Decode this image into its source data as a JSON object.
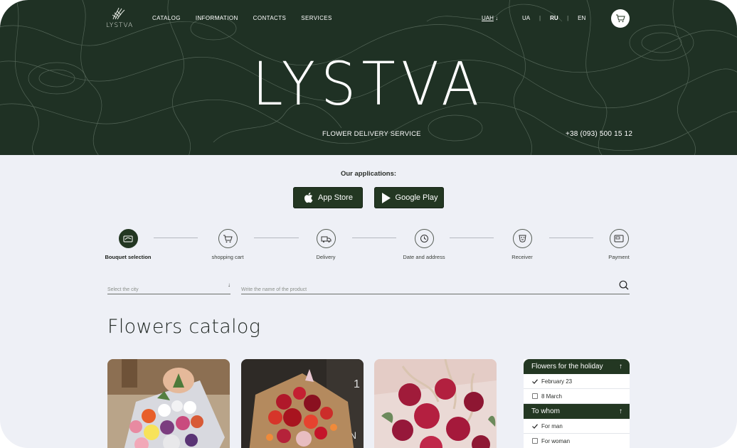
{
  "header": {
    "logo_text": "LYSTVA",
    "nav": [
      "CATALOG",
      "INFORMATION",
      "CONTACTS",
      "SERVICES"
    ],
    "currency": "UAH",
    "currency_arrow": "↓",
    "languages": [
      "UA",
      "RU",
      "EN"
    ],
    "active_language": "RU",
    "cart_icon": "cart-icon"
  },
  "hero": {
    "brand": "LYSTVA",
    "tagline": "FLOWER DELIVERY SERVICE",
    "phone": "+38 (093) 500 15 12"
  },
  "apps": {
    "title": "Our applications:",
    "app_store": "App Store",
    "google_play": "Google Play"
  },
  "steps": [
    {
      "label": "Bouquet selection",
      "icon": "bouquet-icon",
      "active": true
    },
    {
      "label": "shopping cart",
      "icon": "cart-icon",
      "active": false
    },
    {
      "label": "Delivery",
      "icon": "delivery-icon",
      "active": false
    },
    {
      "label": "Date and address",
      "icon": "clock-icon",
      "active": false
    },
    {
      "label": "Receiver",
      "icon": "receiver-icon",
      "active": false
    },
    {
      "label": "Payment",
      "icon": "card-icon",
      "active": false
    }
  ],
  "search": {
    "city_placeholder": "Select the city",
    "city_arrow": "↓",
    "product_placeholder": "Write the name of the product"
  },
  "catalog": {
    "title": "Flowers catalog"
  },
  "filters": [
    {
      "title": "Flowers for the holiday",
      "arrow": "↑",
      "items": [
        {
          "label": "February 23",
          "checked": true
        },
        {
          "label": "8 March",
          "checked": false
        }
      ]
    },
    {
      "title": "To whom",
      "arrow": "↑",
      "items": [
        {
          "label": "For man",
          "checked": true
        },
        {
          "label": "For woman",
          "checked": false
        }
      ]
    }
  ],
  "colors": {
    "hero_bg": "#1f3124",
    "accent": "#233722",
    "page_bg": "#eef0f6"
  }
}
